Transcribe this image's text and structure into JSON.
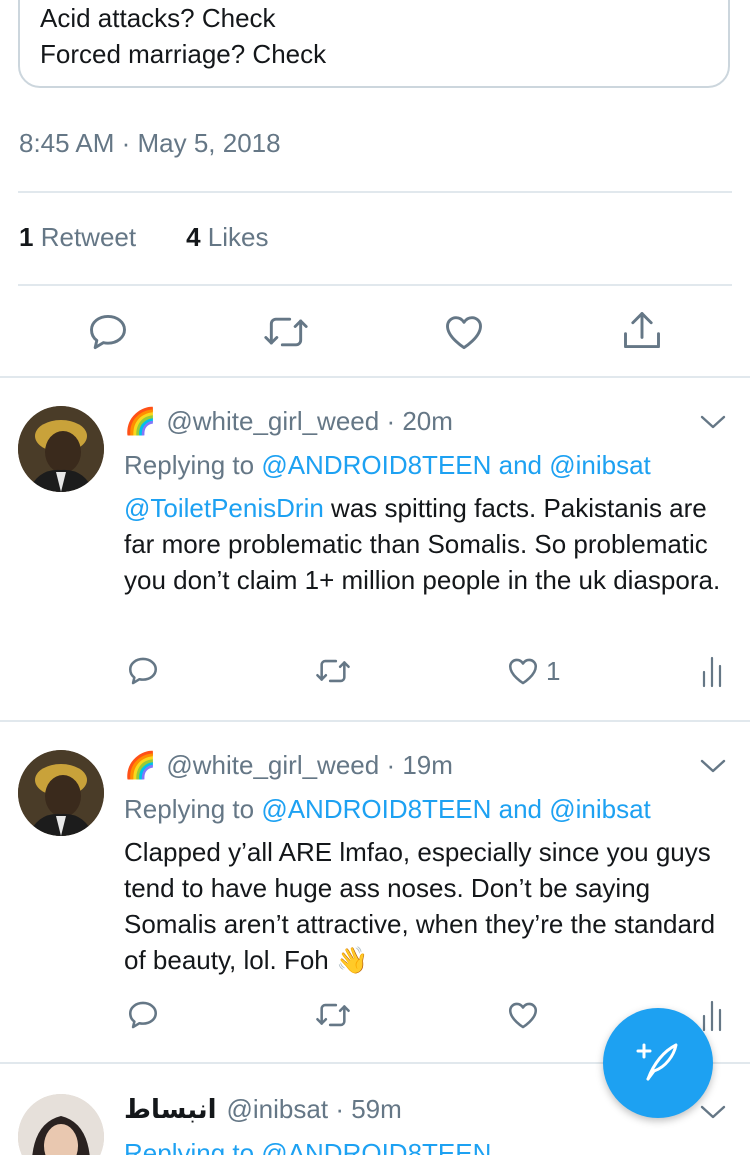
{
  "quoted_tweet": {
    "lines": [
      "Acid attacks? Check",
      "Forced marriage? Check"
    ]
  },
  "main_tweet": {
    "timestamp": "8:45 AM · May 5, 2018",
    "retweets_count": "1",
    "retweets_label": "Retweet",
    "likes_count": "4",
    "likes_label": "Likes"
  },
  "replies": [
    {
      "display_name": "🌈",
      "handle": "@white_girl_weed",
      "time": "· 20m",
      "replying_prefix": "Replying to",
      "replying_to": "@ANDROID8TEEN and @inibsat",
      "mention": "@ToiletPenisDrin",
      "text": " was spitting facts. Pakistanis are far more problematic than Somalis. So problematic you don’t claim 1+ million people in the uk diaspora.",
      "like_count": "1"
    },
    {
      "display_name": "🌈",
      "handle": "@white_girl_weed",
      "time": "· 19m",
      "replying_prefix": "Replying to",
      "replying_to": "@ANDROID8TEEN and @inibsat",
      "text": "Clapped y’all ARE lmfao, especially since you guys tend to have huge ass noses. Don’t be saying Somalis aren’t attractive, when they’re the standard of beauty, lol. Foh",
      "emoji": "👋"
    },
    {
      "display_name": "انبساط",
      "handle": "@inibsat",
      "time": "· 59m",
      "replying_partial": "Replying to @ANDROID8TEEN"
    }
  ],
  "icons": {
    "reply": "reply-icon",
    "retweet": "retweet-icon",
    "like": "heart-icon",
    "share": "share-icon",
    "analytics": "analytics-icon",
    "more": "chevron-down-icon",
    "compose": "compose-tweet-icon"
  },
  "colors": {
    "accent": "#1da1f2",
    "muted": "#657786",
    "divider": "#e1e8ed"
  }
}
